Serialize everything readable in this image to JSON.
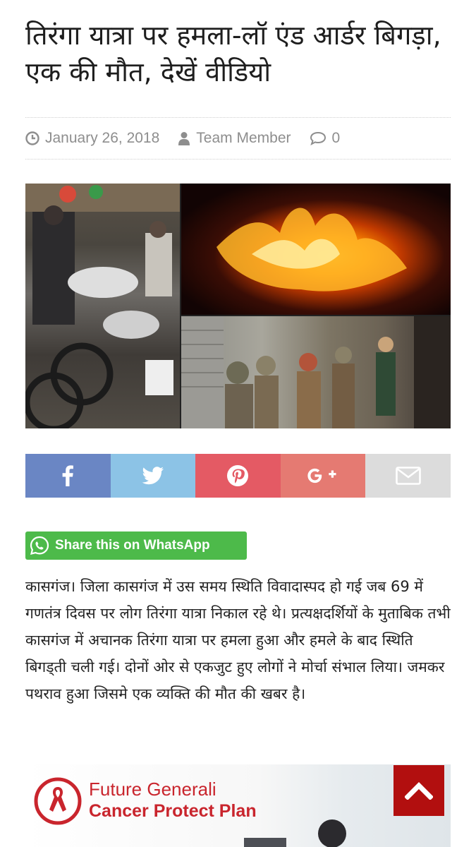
{
  "article": {
    "title": "तिरंगा यात्रा पर हमला-लॉ एंड आर्डर बिगड़ा, एक की मौत, देखें वीडियो",
    "date": "January 26, 2018",
    "author": "Team Member",
    "comments": "0",
    "body": "कासगंज। जिला कासगंज में उस समय स्थिति विवादास्पद हो गई जब 69 में गणतंत्र दिवस पर लोग तिरंगा यात्रा निकाल रहे थे। प्रत्यक्षदर्शियों के मुताबिक तभी कासगंज में अचानक तिरंगा यात्रा पर हमला हुआ और हमले के बाद स्थिति बिगड्ती चली गई। दोनों ओर से एकजुट हुए लोगों ने मोर्चा संभाल लिया। जमकर पथराव हुआ जिसमे एक व्यक्ति की मौत की खबर है।"
  },
  "share_buttons": [
    {
      "network": "facebook",
      "icon": "facebook-icon",
      "color": "#6a86c4"
    },
    {
      "network": "twitter",
      "icon": "twitter-icon",
      "color": "#8cc3e6"
    },
    {
      "network": "pinterest",
      "icon": "pinterest-icon",
      "color": "#e45a64"
    },
    {
      "network": "google-plus",
      "icon": "google-plus-icon",
      "color": "#e57a72"
    },
    {
      "network": "email",
      "icon": "envelope-icon",
      "color": "#dcdcdc"
    }
  ],
  "whatsapp": {
    "label": "Share this on WhatsApp",
    "color": "#4dba4a"
  },
  "ad": {
    "line1": "Future Generali",
    "line2": "Cancer Protect Plan"
  },
  "colors": {
    "back_to_top": "#b20f0f",
    "meta_text": "#8e8e8e"
  }
}
